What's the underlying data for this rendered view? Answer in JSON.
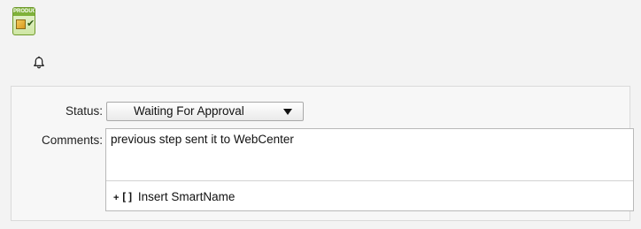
{
  "header": {
    "product_icon_tag": "PRODUCT",
    "product_icon": "product-check-icon",
    "bell_icon": "bell-icon"
  },
  "form": {
    "status_label": "Status:",
    "status_value": "Waiting For Approval",
    "comments_label": "Comments:",
    "comments_value": "previous step sent it to WebCenter",
    "insert_smartname_plus": "+",
    "insert_smartname_brackets": "[]",
    "insert_smartname_label": "Insert SmartName"
  }
}
